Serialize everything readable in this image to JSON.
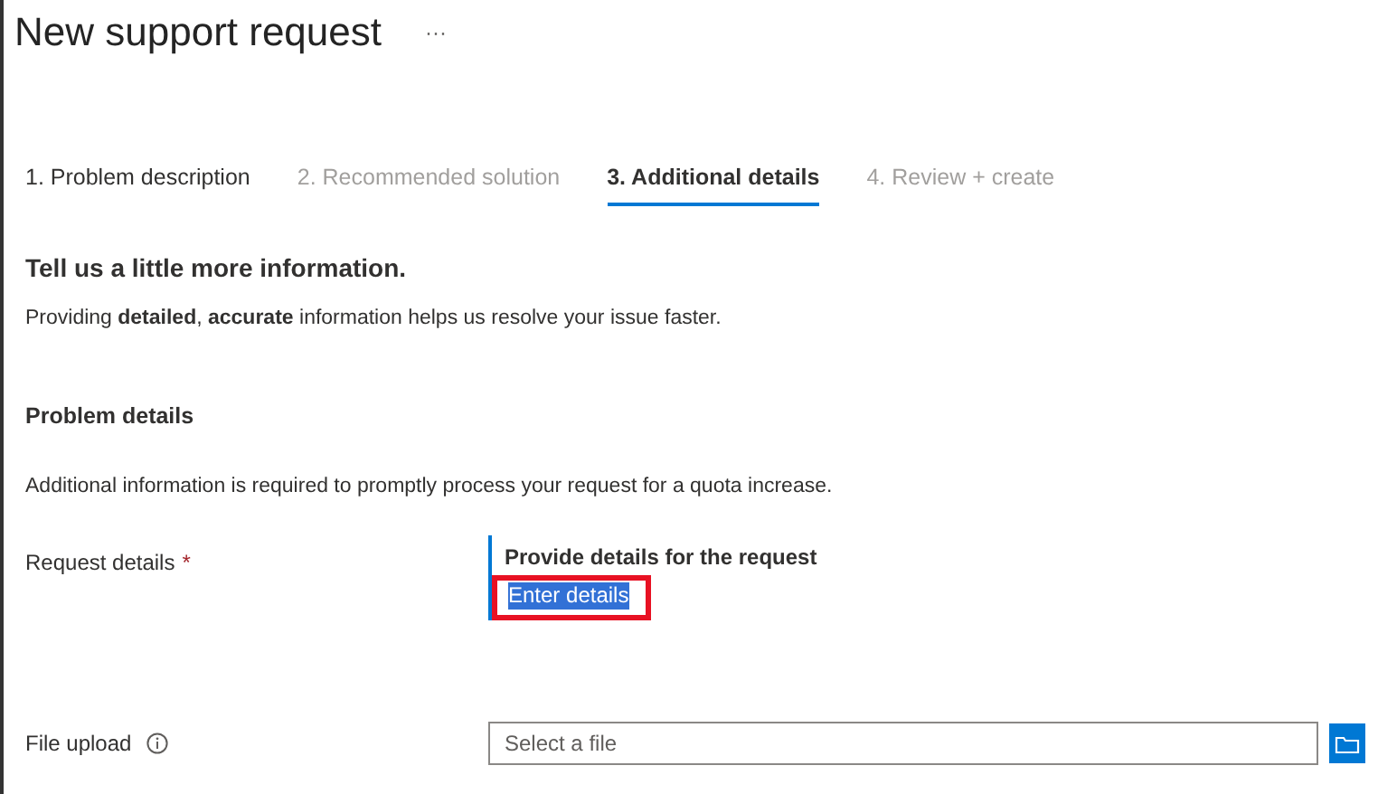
{
  "header": {
    "title": "New support request",
    "more": "···"
  },
  "steps": [
    {
      "label": "1. Problem description",
      "selected": false,
      "disabled": false
    },
    {
      "label": "2. Recommended solution",
      "selected": false,
      "disabled": true
    },
    {
      "label": "3. Additional details",
      "selected": true,
      "disabled": false
    },
    {
      "label": "4. Review + create",
      "selected": false,
      "disabled": true
    }
  ],
  "intro": {
    "heading": "Tell us a little more information.",
    "text": "Providing **detailed**, **accurate** information helps us resolve your issue faster."
  },
  "problem_details": {
    "heading": "Problem details",
    "text": "Additional information is required to promptly process your request for a quota increase."
  },
  "request_details": {
    "label": "Request details",
    "required_mark": "*",
    "prompt": "Provide details for the request",
    "value": "Enter details",
    "text_selected": true,
    "annotated": true
  },
  "file_upload": {
    "label": "File upload",
    "placeholder": "Select a file"
  }
}
